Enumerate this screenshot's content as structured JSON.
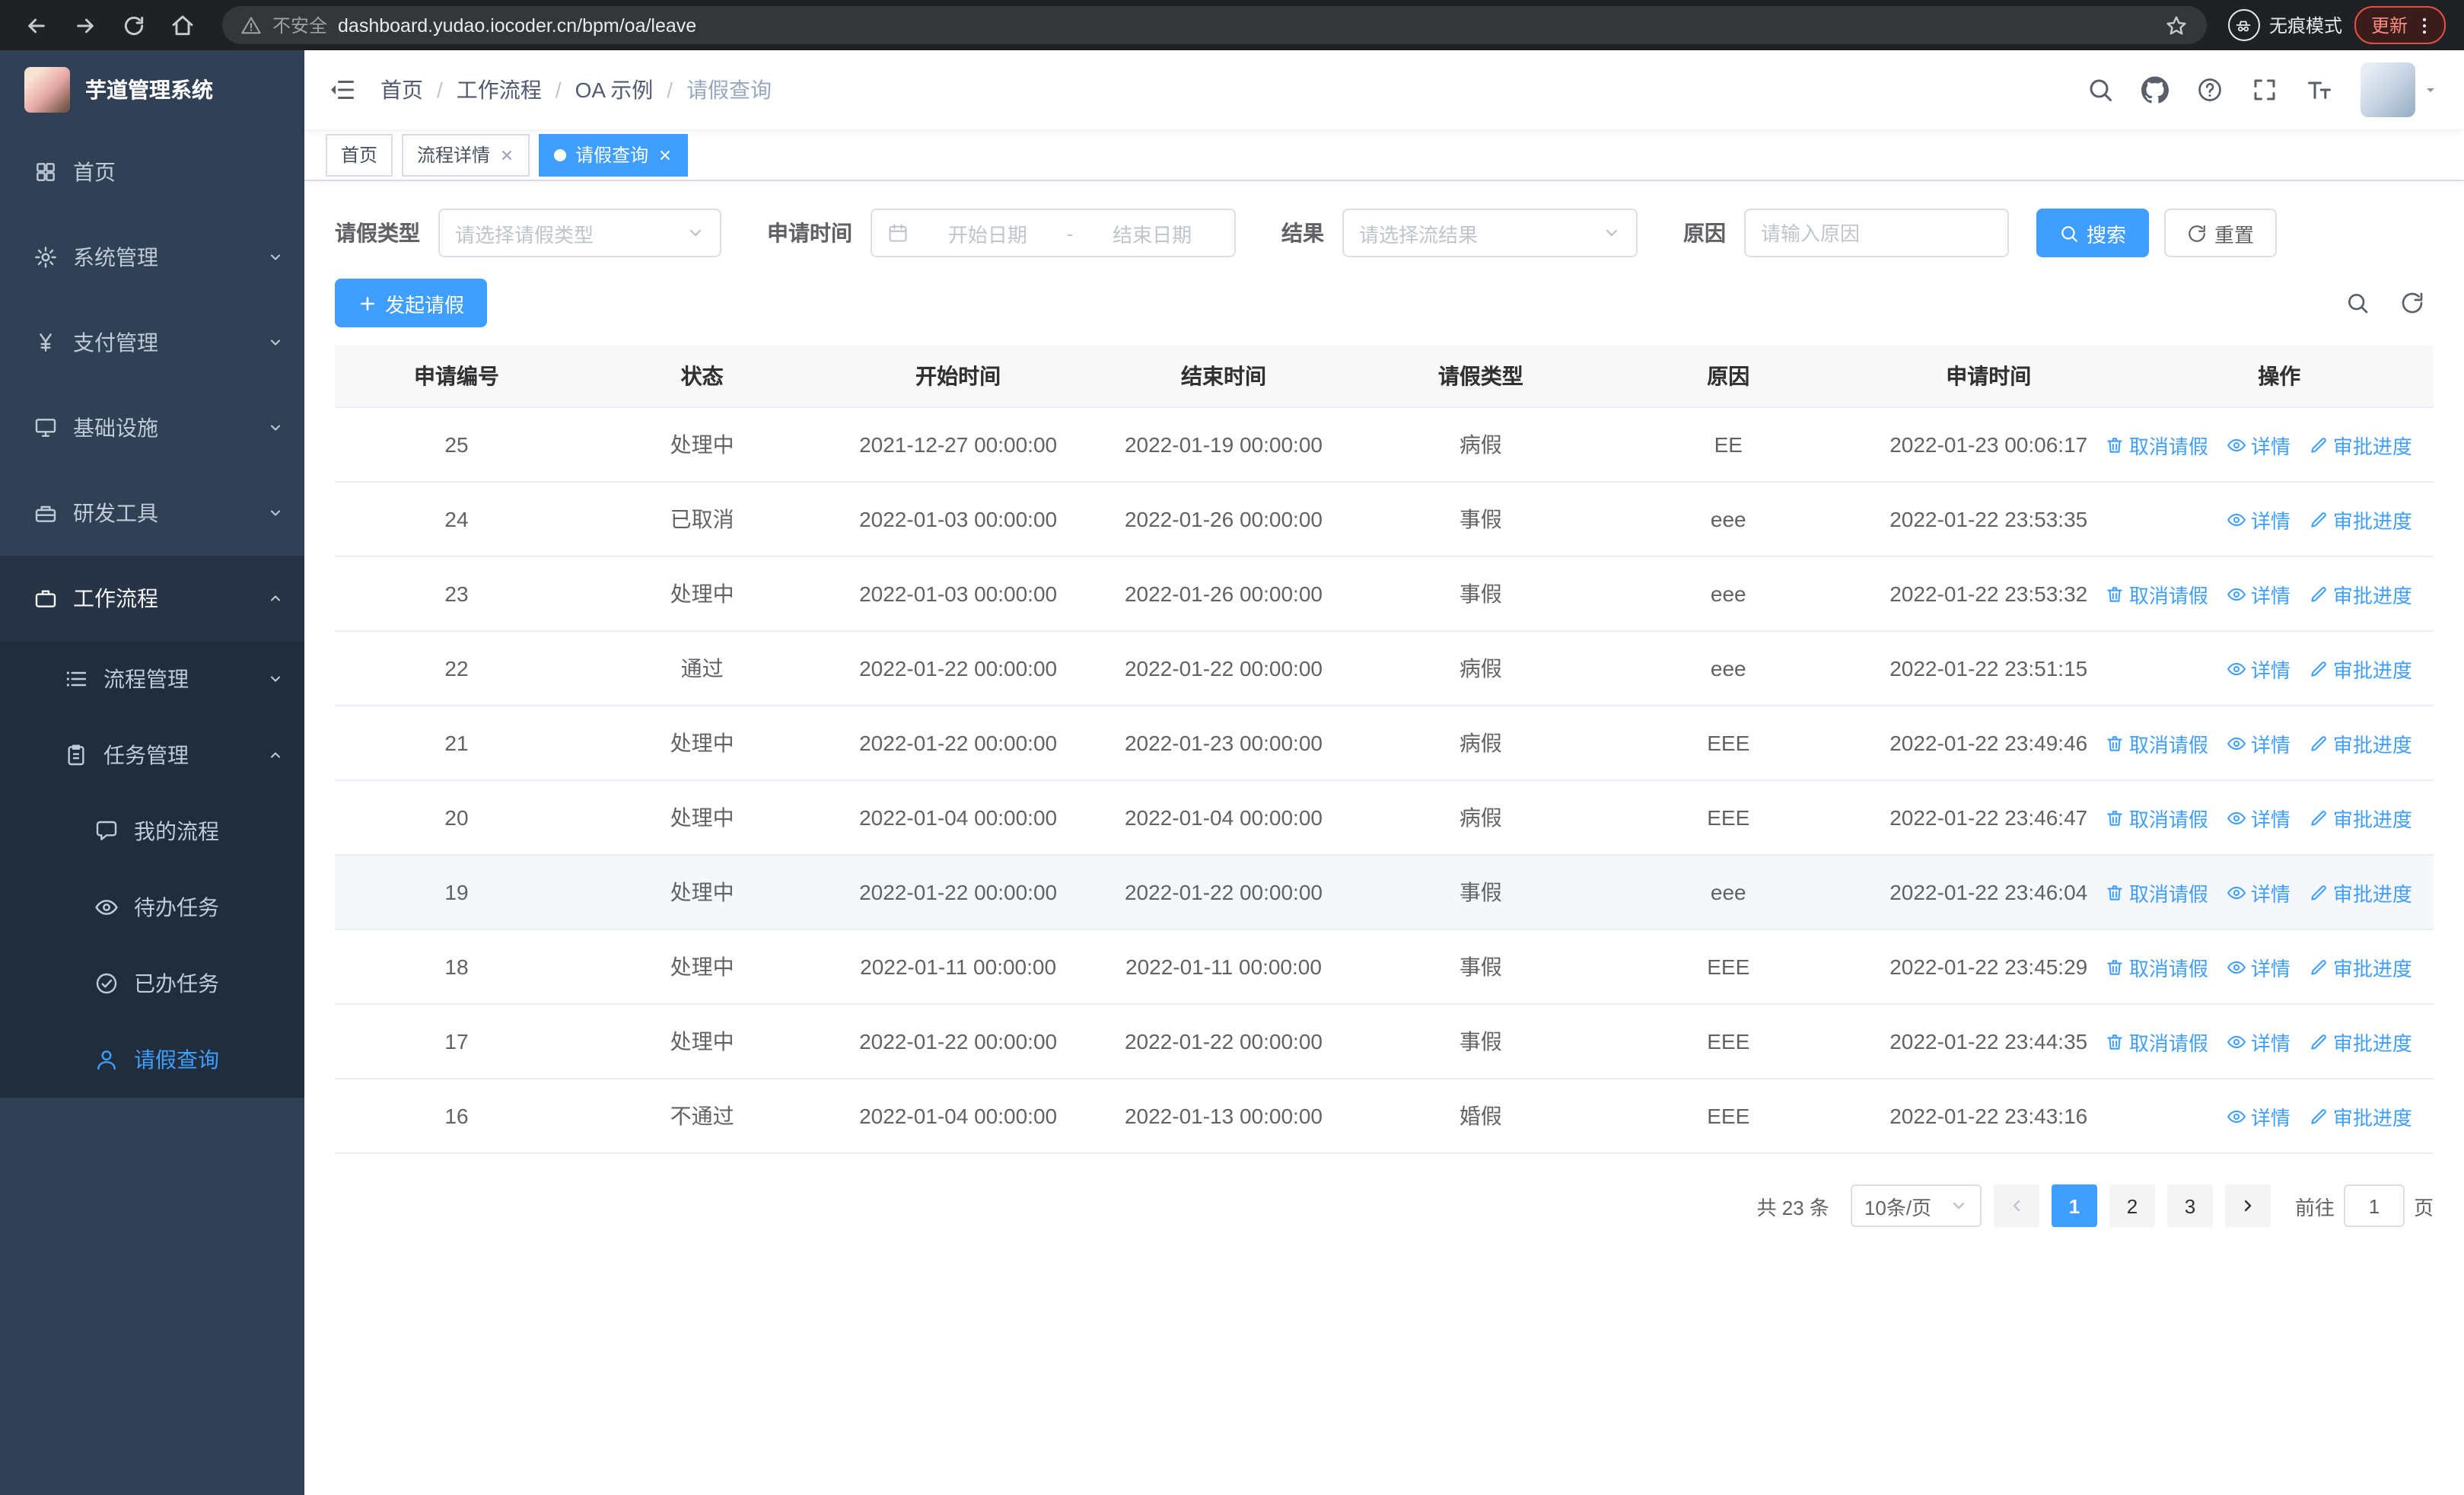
{
  "browser": {
    "security_label": "不安全",
    "url": "dashboard.yudao.iocoder.cn/bpm/oa/leave",
    "incognito_label": "无痕模式",
    "update_label": "更新"
  },
  "sidebar": {
    "logo_title": "芋道管理系统",
    "items": [
      {
        "label": "首页",
        "icon": "dashboard-icon"
      },
      {
        "label": "系统管理",
        "icon": "gear-icon"
      },
      {
        "label": "支付管理",
        "icon": "yen-icon"
      },
      {
        "label": "基础设施",
        "icon": "monitor-icon"
      },
      {
        "label": "研发工具",
        "icon": "toolbox-icon"
      },
      {
        "label": "工作流程",
        "icon": "briefcase-icon"
      }
    ],
    "sub_items": [
      {
        "label": "流程管理",
        "icon": "list-icon"
      },
      {
        "label": "任务管理",
        "icon": "clipboard-icon"
      }
    ],
    "task_items": [
      {
        "label": "我的流程",
        "icon": "chat-icon"
      },
      {
        "label": "待办任务",
        "icon": "eye-icon"
      },
      {
        "label": "已办任务",
        "icon": "check-circle-icon"
      },
      {
        "label": "请假查询",
        "icon": "user-icon"
      }
    ]
  },
  "header": {
    "breadcrumb": [
      "首页",
      "工作流程",
      "OA 示例",
      "请假查询"
    ]
  },
  "tabs": [
    {
      "label": "首页",
      "active": false,
      "closable": false
    },
    {
      "label": "流程详情",
      "active": false,
      "closable": true
    },
    {
      "label": "请假查询",
      "active": true,
      "closable": true
    }
  ],
  "filters": {
    "leave_type_label": "请假类型",
    "leave_type_placeholder": "请选择请假类型",
    "apply_time_label": "申请时间",
    "start_date_placeholder": "开始日期",
    "date_separator": "-",
    "end_date_placeholder": "结束日期",
    "result_label": "结果",
    "result_placeholder": "请选择流结果",
    "reason_label": "原因",
    "reason_placeholder": "请输入原因",
    "search_button": "搜索",
    "reset_button": "重置"
  },
  "toolbar": {
    "create_button": "发起请假"
  },
  "table": {
    "columns": [
      "申请编号",
      "状态",
      "开始时间",
      "结束时间",
      "请假类型",
      "原因",
      "申请时间",
      "操作"
    ],
    "action_labels": {
      "cancel": "取消请假",
      "detail": "详情",
      "progress": "审批进度"
    },
    "rows": [
      {
        "id": "25",
        "status": "处理中",
        "start": "2021-12-27 00:00:00",
        "end": "2022-01-19 00:00:00",
        "type": "病假",
        "reason": "EE",
        "apply_time": "2022-01-23 00:06:17",
        "actions": [
          "cancel",
          "detail",
          "progress"
        ]
      },
      {
        "id": "24",
        "status": "已取消",
        "start": "2022-01-03 00:00:00",
        "end": "2022-01-26 00:00:00",
        "type": "事假",
        "reason": "eee",
        "apply_time": "2022-01-22 23:53:35",
        "actions": [
          "detail",
          "progress"
        ]
      },
      {
        "id": "23",
        "status": "处理中",
        "start": "2022-01-03 00:00:00",
        "end": "2022-01-26 00:00:00",
        "type": "事假",
        "reason": "eee",
        "apply_time": "2022-01-22 23:53:32",
        "actions": [
          "cancel",
          "detail",
          "progress"
        ]
      },
      {
        "id": "22",
        "status": "通过",
        "start": "2022-01-22 00:00:00",
        "end": "2022-01-22 00:00:00",
        "type": "病假",
        "reason": "eee",
        "apply_time": "2022-01-22 23:51:15",
        "actions": [
          "detail",
          "progress"
        ]
      },
      {
        "id": "21",
        "status": "处理中",
        "start": "2022-01-22 00:00:00",
        "end": "2022-01-23 00:00:00",
        "type": "病假",
        "reason": "EEE",
        "apply_time": "2022-01-22 23:49:46",
        "actions": [
          "cancel",
          "detail",
          "progress"
        ]
      },
      {
        "id": "20",
        "status": "处理中",
        "start": "2022-01-04 00:00:00",
        "end": "2022-01-04 00:00:00",
        "type": "病假",
        "reason": "EEE",
        "apply_time": "2022-01-22 23:46:47",
        "actions": [
          "cancel",
          "detail",
          "progress"
        ]
      },
      {
        "id": "19",
        "status": "处理中",
        "start": "2022-01-22 00:00:00",
        "end": "2022-01-22 00:00:00",
        "type": "事假",
        "reason": "eee",
        "apply_time": "2022-01-22 23:46:04",
        "actions": [
          "cancel",
          "detail",
          "progress"
        ],
        "highlight": true
      },
      {
        "id": "18",
        "status": "处理中",
        "start": "2022-01-11 00:00:00",
        "end": "2022-01-11 00:00:00",
        "type": "事假",
        "reason": "EEE",
        "apply_time": "2022-01-22 23:45:29",
        "actions": [
          "cancel",
          "detail",
          "progress"
        ]
      },
      {
        "id": "17",
        "status": "处理中",
        "start": "2022-01-22 00:00:00",
        "end": "2022-01-22 00:00:00",
        "type": "事假",
        "reason": "EEE",
        "apply_time": "2022-01-22 23:44:35",
        "actions": [
          "cancel",
          "detail",
          "progress"
        ]
      },
      {
        "id": "16",
        "status": "不通过",
        "start": "2022-01-04 00:00:00",
        "end": "2022-01-13 00:00:00",
        "type": "婚假",
        "reason": "EEE",
        "apply_time": "2022-01-22 23:43:16",
        "actions": [
          "detail",
          "progress"
        ]
      }
    ]
  },
  "pagination": {
    "total_text": "共 23 条",
    "page_size": "10条/页",
    "pages": [
      "1",
      "2",
      "3"
    ],
    "active_page": "1",
    "goto_label": "前往",
    "goto_value": "1",
    "page_suffix": "页"
  },
  "icons": {
    "search": "magnifier",
    "github": "octocat",
    "help": "question-circle",
    "fullscreen": "expand-corners",
    "refresh": "circular-arrow",
    "delete": "trash-can",
    "view": "eye",
    "edit": "pen",
    "calendar": "calendar-grid",
    "incognito": "hat-and-glasses",
    "warning": "triangle-exclamation"
  },
  "colors": {
    "primary": "#409eff",
    "sidebar_bg": "#304156",
    "submenu_bg": "#1f2d3d",
    "sidebar_text": "#bfcbd9",
    "tab_active": "#409eff",
    "update_chip": "#e25142"
  }
}
